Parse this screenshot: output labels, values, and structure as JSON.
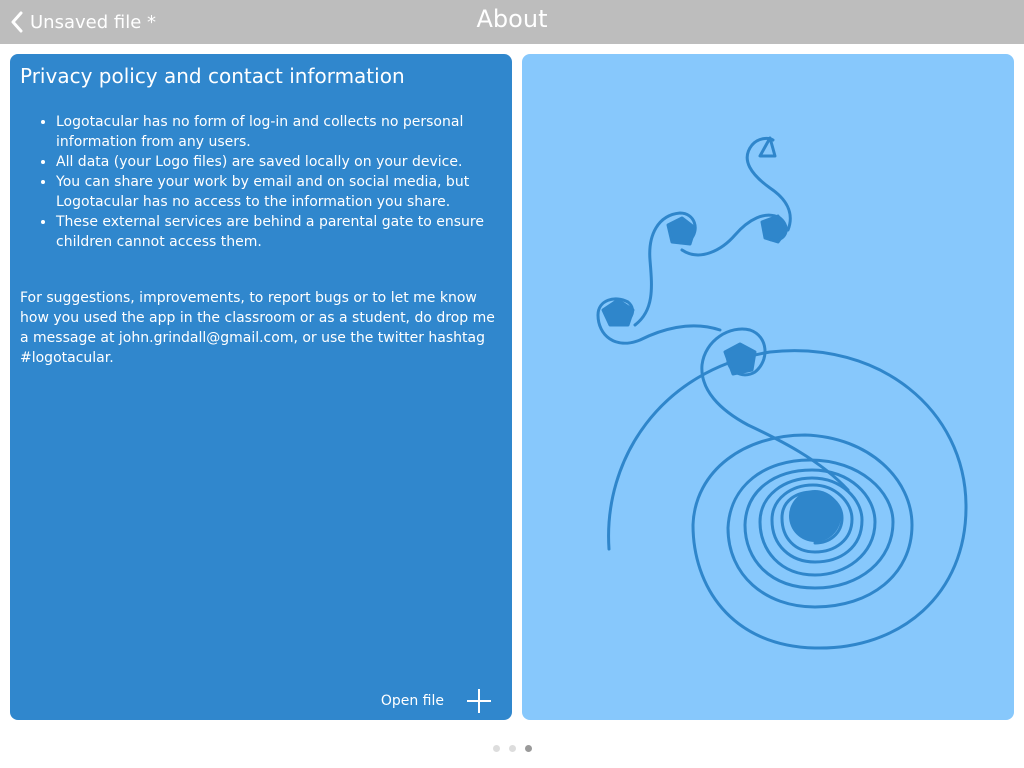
{
  "header": {
    "back_label": "Unsaved file *",
    "title": "About"
  },
  "left_panel": {
    "heading": "Privacy policy and contact information",
    "bullets": [
      "Logotacular has no form of log-in and collects no personal information from any users.",
      "All data (your Logo files) are saved locally on your device.",
      "You can share your work by email and on social media, but Logotacular has no access to the information you share.",
      "These external services are behind a parental gate to ensure children cannot access them."
    ],
    "contact_text": "For suggestions, improvements, to report bugs or to let me know how you used the app in the classroom or as a student, do drop me a message at john.grindall@gmail.com, or use the twitter hashtag #logotacular.",
    "open_file_label": "Open file",
    "open_file_icon": "plus-icon"
  },
  "right_panel": {
    "drawing": "spiral-curl-drawing"
  },
  "colors": {
    "header_bg": "#bdbdbd",
    "panel_dark": "#3087cd",
    "panel_light": "#87c8fc",
    "stroke": "#2f86cb"
  },
  "pagination": {
    "count": 3,
    "active_index": 2
  }
}
